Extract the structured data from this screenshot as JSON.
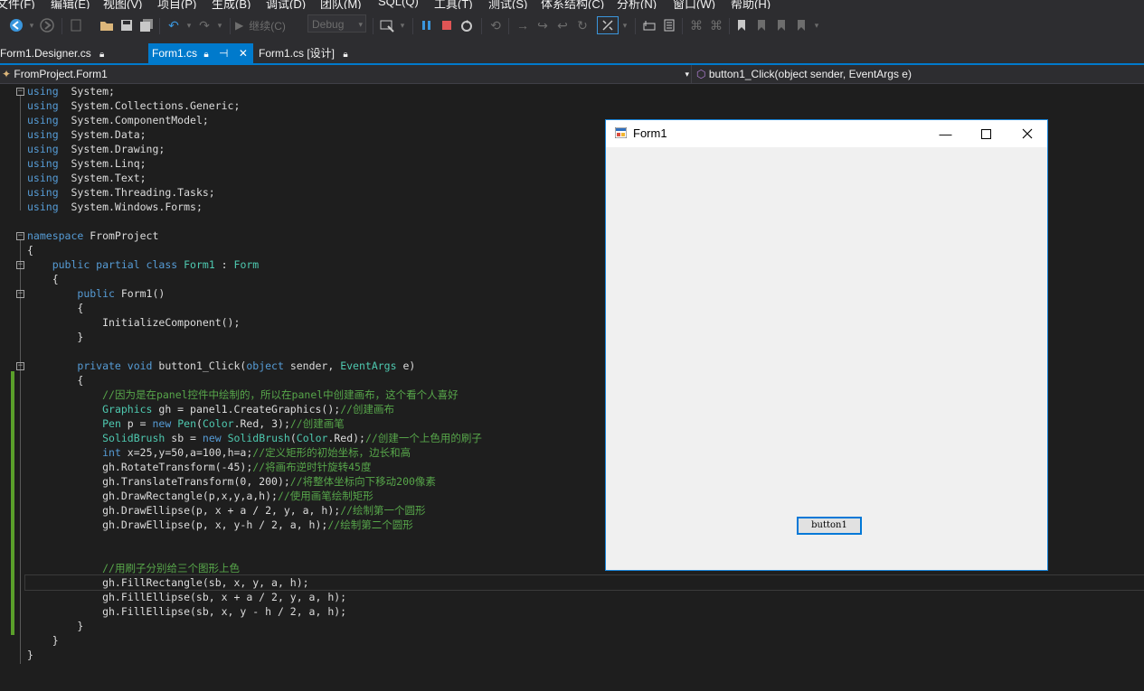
{
  "menu": [
    "文件(F)",
    "编辑(E)",
    "视图(V)",
    "项目(P)",
    "生成(B)",
    "调试(D)",
    "团队(M)",
    "SQL(Q)",
    "工具(T)",
    "测试(S)",
    "体系结构(C)",
    "分析(N)",
    "窗口(W)",
    "帮助(H)"
  ],
  "toolbar": {
    "continue_label": "继续(C)",
    "config_value": "Debug"
  },
  "tabs": [
    {
      "label": "Form1.Designer.cs"
    },
    {
      "label": "Form1.cs"
    },
    {
      "label": "Form1.cs [设计]"
    }
  ],
  "nav": {
    "class_path": "FromProject.Form1",
    "member": "button1_Click(object sender, EventArgs e)"
  },
  "code_lines": [
    [
      [
        "kw",
        "using"
      ],
      [
        "",
        "  System;"
      ]
    ],
    [
      [
        "kw",
        "using"
      ],
      [
        "",
        "  System.Collections.Generic;"
      ]
    ],
    [
      [
        "kw",
        "using"
      ],
      [
        "",
        "  System.ComponentModel;"
      ]
    ],
    [
      [
        "kw",
        "using"
      ],
      [
        "",
        "  System.Data;"
      ]
    ],
    [
      [
        "kw",
        "using"
      ],
      [
        "",
        "  System.Drawing;"
      ]
    ],
    [
      [
        "kw",
        "using"
      ],
      [
        "",
        "  System.Linq;"
      ]
    ],
    [
      [
        "kw",
        "using"
      ],
      [
        "",
        "  System.Text;"
      ]
    ],
    [
      [
        "kw",
        "using"
      ],
      [
        "",
        "  System.Threading.Tasks;"
      ]
    ],
    [
      [
        "kw",
        "using"
      ],
      [
        "",
        "  System.Windows.Forms;"
      ]
    ],
    [],
    [
      [
        "kw",
        "namespace"
      ],
      [
        "",
        " FromProject"
      ]
    ],
    [
      [
        "",
        "{"
      ]
    ],
    [
      [
        "",
        "    "
      ],
      [
        "kw",
        "public partial class"
      ],
      [
        "",
        " "
      ],
      [
        "ty",
        "Form1"
      ],
      [
        "",
        " : "
      ],
      [
        "ty",
        "Form"
      ]
    ],
    [
      [
        "",
        "    {"
      ]
    ],
    [
      [
        "",
        "        "
      ],
      [
        "kw",
        "public"
      ],
      [
        "",
        " Form1()"
      ]
    ],
    [
      [
        "",
        "        {"
      ]
    ],
    [
      [
        "",
        "            InitializeComponent();"
      ]
    ],
    [
      [
        "",
        "        }"
      ]
    ],
    [],
    [
      [
        "",
        "        "
      ],
      [
        "kw",
        "private void"
      ],
      [
        "",
        " button1_Click("
      ],
      [
        "kw",
        "object"
      ],
      [
        "",
        " sender, "
      ],
      [
        "ty",
        "EventArgs"
      ],
      [
        "",
        " e)"
      ]
    ],
    [
      [
        "",
        "        {"
      ]
    ],
    [
      [
        "",
        "            "
      ],
      [
        "cm",
        "//因为是在panel控件中绘制的，所以在panel中创建画布，这个看个人喜好"
      ]
    ],
    [
      [
        "",
        "            "
      ],
      [
        "ty",
        "Graphics"
      ],
      [
        "",
        " gh = panel1.CreateGraphics();"
      ],
      [
        "cm",
        "//创建画布"
      ]
    ],
    [
      [
        "",
        "            "
      ],
      [
        "ty",
        "Pen"
      ],
      [
        "",
        " p = "
      ],
      [
        "kw",
        "new"
      ],
      [
        "",
        " "
      ],
      [
        "ty",
        "Pen"
      ],
      [
        "",
        "("
      ],
      [
        "ty",
        "Color"
      ],
      [
        "",
        ".Red, 3);"
      ],
      [
        "cm",
        "//创建画笔"
      ]
    ],
    [
      [
        "",
        "            "
      ],
      [
        "ty",
        "SolidBrush"
      ],
      [
        "",
        " sb = "
      ],
      [
        "kw",
        "new"
      ],
      [
        "",
        " "
      ],
      [
        "ty",
        "SolidBrush"
      ],
      [
        "",
        "("
      ],
      [
        "ty",
        "Color"
      ],
      [
        "",
        ".Red);"
      ],
      [
        "cm",
        "//创建一个上色用的刷子"
      ]
    ],
    [
      [
        "",
        "            "
      ],
      [
        "kw",
        "int"
      ],
      [
        "",
        " x=25,y=50,a=100,h=a;"
      ],
      [
        "cm",
        "//定义矩形的初始坐标，边长和高"
      ]
    ],
    [
      [
        "",
        "            gh.RotateTransform(-45);"
      ],
      [
        "cm",
        "//将画布逆时针旋转45度"
      ]
    ],
    [
      [
        "",
        "            gh.TranslateTransform(0, 200);"
      ],
      [
        "cm",
        "//将整体坐标向下移动200像素"
      ]
    ],
    [
      [
        "",
        "            gh.DrawRectangle(p,x,y,a,h);"
      ],
      [
        "cm",
        "//使用画笔绘制矩形"
      ]
    ],
    [
      [
        "",
        "            gh.DrawEllipse(p, x + a / 2, y, a, h);"
      ],
      [
        "cm",
        "//绘制第一个圆形"
      ]
    ],
    [
      [
        "",
        "            gh.DrawEllipse(p, x, y-h / 2, a, h);"
      ],
      [
        "cm",
        "//绘制第二个圆形"
      ]
    ],
    [],
    [],
    [
      [
        "",
        "            "
      ],
      [
        "cm",
        "//用刷子分别给三个图形上色"
      ]
    ],
    [
      [
        "",
        "            gh.FillRectangle(sb, x, y, a, h);"
      ]
    ],
    [
      [
        "",
        "            gh.FillEllipse(sb, x + a / 2, y, a, h);"
      ]
    ],
    [
      [
        "",
        "            gh.FillEllipse(sb, x, y - h / 2, a, h);"
      ]
    ],
    [
      [
        "",
        "        }"
      ]
    ],
    [
      [
        "",
        "    }"
      ]
    ],
    [
      [
        "",
        "}"
      ]
    ]
  ],
  "form": {
    "title": "Form1",
    "button_label": "button1"
  }
}
